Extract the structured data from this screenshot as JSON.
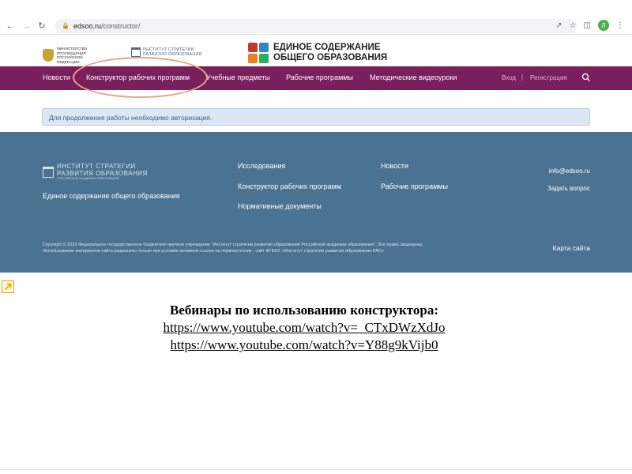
{
  "browser": {
    "url_domain": "edsoo.ru",
    "url_path": "/constructor/",
    "avatar_letter": "Л"
  },
  "header": {
    "ministry_text": "МИНИСТЕРСТВО ПРОСВЕЩЕНИЯ РОССИЙСКОЙ ФЕДЕРАЦИИ",
    "institute_text": "ИНСТИТУТ СТРАТЕГИИ РАЗВИТИЯ ОБРАЗОВАНИЯ",
    "brand_line1": "ЕДИНОЕ СОДЕРЖАНИЕ",
    "brand_line2": "ОБЩЕГО ОБРАЗОВАНИЯ",
    "brand_colors": [
      "#c0392b",
      "#2e86c1",
      "#e67e22",
      "#27ae60"
    ]
  },
  "nav": {
    "items": [
      "Новости",
      "Конструктор рабочих программ",
      "Учебные предметы",
      "Рабочие программы",
      "Методические видеоуроки"
    ],
    "login": "Вход",
    "separator": "|",
    "register": "Регистрация",
    "bg_color": "#7a1f5d"
  },
  "notice": {
    "text": "Для продолжения работы необходимо авторизация."
  },
  "footer": {
    "logo_line1": "ИНСТИТУТ СТРАТЕГИИ",
    "logo_line2": "РАЗВИТИЯ ОБРАЗОВАНИЯ",
    "logo_line3": "РОССИЙСКОЙ АКАДЕМИИ ОБРАЗОВАНИЯ",
    "site_name": "Единое содержание общего образования",
    "col1": [
      "Исследования",
      "Конструктор рабочих программ",
      "Нормативные документы"
    ],
    "col2": [
      "Новости",
      "Рабочие программы"
    ],
    "email": "info@edsoo.ru",
    "ask": "Задать вопрос",
    "sitemap": "Карта сайта",
    "copyright_line1": "Copyright © 2022 Федеральное государственное бюджетное научное учреждение \"Институт стратегии развития образования Российской академии образования\". Все права защищены.",
    "copyright_line2": "Использование материалов сайта разрешено только при условии активной ссылки на первоисточник - сайт ФГБНУ «Институт стратегии развития образования РАО»",
    "bg_color": "#4a7393"
  },
  "slide": {
    "title": "Вебинары по использованию конструктора:",
    "link1": "https://www.youtube.com/watch?v=_CTxDWzXdJo",
    "link2": "https://www.youtube.com/watch?v=Y88g9kVijb0"
  }
}
